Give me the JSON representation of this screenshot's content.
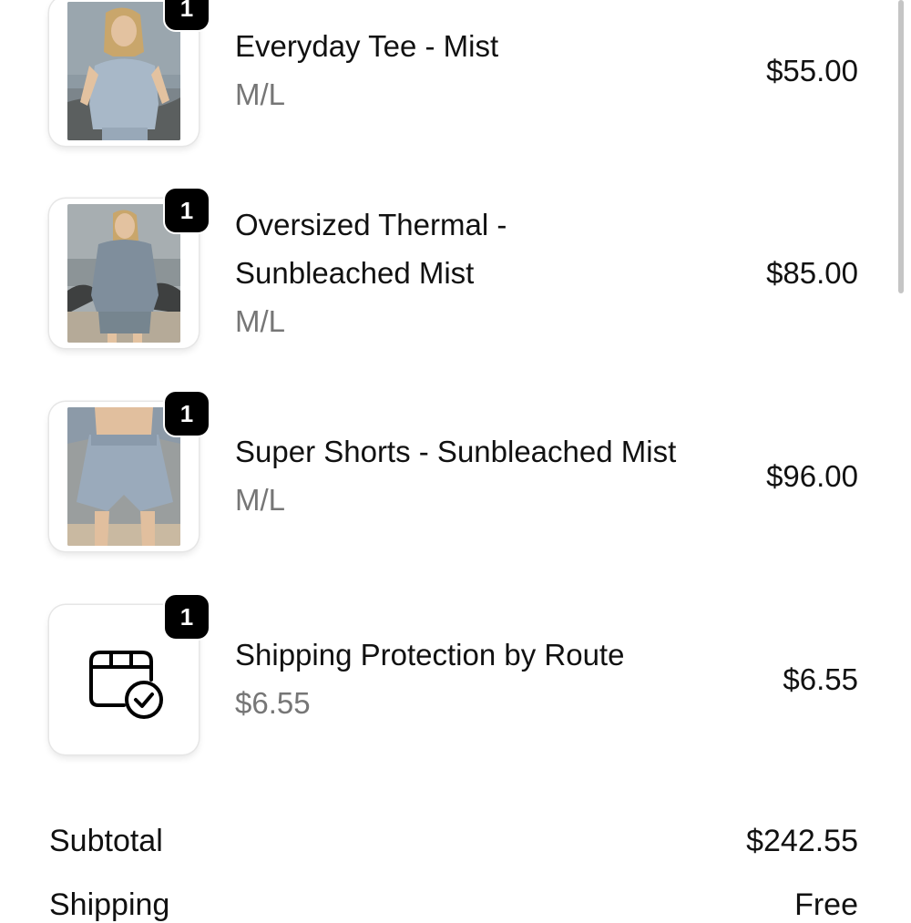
{
  "cart": {
    "items": [
      {
        "title": "Everyday Tee - Mist",
        "title_line2": "",
        "variant": "M/L",
        "price": "$55.00",
        "quantity": "1"
      },
      {
        "title": "Oversized Thermal -",
        "title_line2": "Sunbleached Mist",
        "variant": "M/L",
        "price": "$85.00",
        "quantity": "1"
      },
      {
        "title": "Super Shorts - Sunbleached Mist",
        "title_line2": "",
        "variant": "M/L",
        "price": "$96.00",
        "quantity": "1"
      },
      {
        "title": "Shipping Protection by Route",
        "title_line2": "",
        "variant": "$6.55",
        "price": "$6.55",
        "quantity": "1",
        "icon": "package-check-icon"
      }
    ]
  },
  "summary": {
    "subtotal_label": "Subtotal",
    "subtotal_value": "$242.55",
    "shipping_label": "Shipping",
    "shipping_value": "Free"
  },
  "colors": {
    "badge": "#000000",
    "variant_text": "#767676",
    "text": "#111111"
  }
}
